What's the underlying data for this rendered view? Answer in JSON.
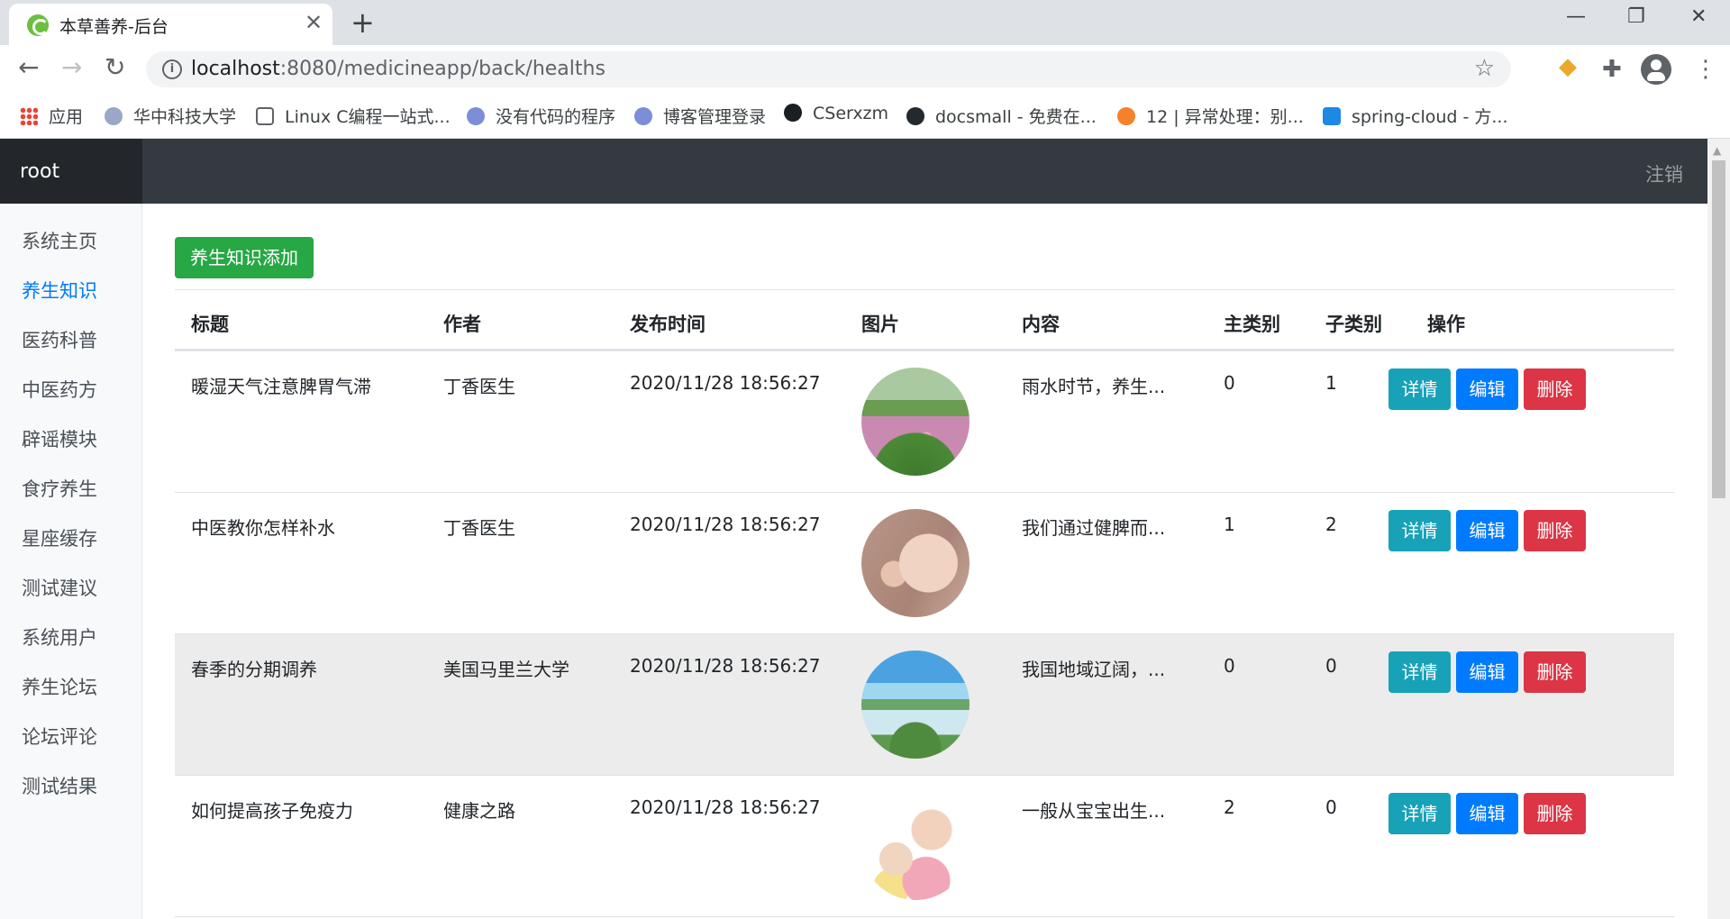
{
  "browser": {
    "tab_title": "本草善养-后台",
    "url_host": "localhost",
    "url_rest": ":8080/medicineapp/back/healths",
    "bookmarks": [
      {
        "label": "应用",
        "icon": "apps-grid-icon"
      },
      {
        "label": "华中科技大学",
        "icon": "university-icon"
      },
      {
        "label": "Linux C编程一站式...",
        "icon": "book-icon"
      },
      {
        "label": "没有代码的程序",
        "icon": "blog-icon"
      },
      {
        "label": "博客管理登录",
        "icon": "blog-icon"
      },
      {
        "label": "CSerxzm",
        "icon": "github-icon"
      },
      {
        "label": "docsmall - 免费在...",
        "icon": "docsmall-icon"
      },
      {
        "label": "12 | 异常处理：别...",
        "icon": "geek-icon"
      },
      {
        "label": "spring-cloud - 方...",
        "icon": "f-icon"
      }
    ]
  },
  "app": {
    "brand": "root",
    "logout": "注销",
    "sidebar": [
      {
        "label": "系统主页",
        "active": false
      },
      {
        "label": "养生知识",
        "active": true
      },
      {
        "label": "医药科普",
        "active": false
      },
      {
        "label": "中医药方",
        "active": false
      },
      {
        "label": "辟谣模块",
        "active": false
      },
      {
        "label": "食疗养生",
        "active": false
      },
      {
        "label": "星座缓存",
        "active": false
      },
      {
        "label": "测试建议",
        "active": false
      },
      {
        "label": "系统用户",
        "active": false
      },
      {
        "label": "养生论坛",
        "active": false
      },
      {
        "label": "论坛评论",
        "active": false
      },
      {
        "label": "测试结果",
        "active": false
      }
    ],
    "add_button": "养生知识添加",
    "columns": [
      "标题",
      "作者",
      "发布时间",
      "图片",
      "内容",
      "主类别",
      "子类别",
      "操作"
    ],
    "rows": [
      {
        "title": "暖湿天气注意脾胃气滞",
        "author": "丁香医生",
        "time": "2020/11/28 18:56:27",
        "image": "flowers-photo",
        "content": "雨水时节，养生...",
        "main_cat": "0",
        "sub_cat": "1"
      },
      {
        "title": "中医教你怎样补水",
        "author": "丁香医生",
        "time": "2020/11/28 18:56:27",
        "image": "face-photo",
        "content": "我们通过健脾而...",
        "main_cat": "1",
        "sub_cat": "2"
      },
      {
        "title": "春季的分期调养",
        "author": "美国马里兰大学",
        "time": "2020/11/28 18:56:27",
        "image": "lake-photo",
        "content": "我国地域辽阔，...",
        "main_cat": "0",
        "sub_cat": "0"
      },
      {
        "title": "如何提高孩子免疫力",
        "author": "健康之路",
        "time": "2020/11/28 18:56:27",
        "image": "kids-photo",
        "content": "一般从宝宝出生...",
        "main_cat": "2",
        "sub_cat": "0"
      }
    ],
    "actions": {
      "detail": "详情",
      "edit": "编辑",
      "delete": "删除"
    }
  }
}
